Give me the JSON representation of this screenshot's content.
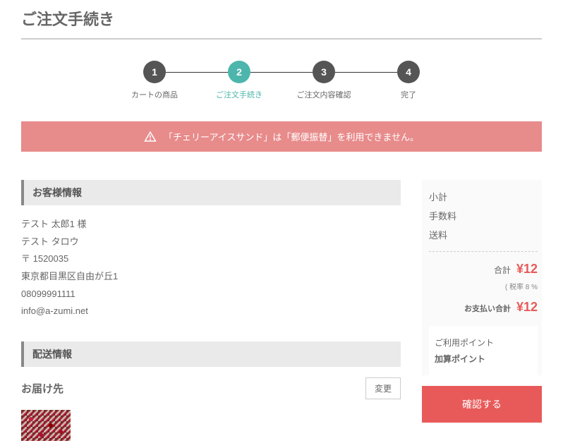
{
  "pageTitle": "ご注文手続き",
  "steps": [
    {
      "num": "1",
      "label": "カートの商品"
    },
    {
      "num": "2",
      "label": "ご注文手続き"
    },
    {
      "num": "3",
      "label": "ご注文内容確認"
    },
    {
      "num": "4",
      "label": "完了"
    }
  ],
  "alert": "「チェリーアイスサンド」は「郵便振替」を利用できません。",
  "sections": {
    "customer": "お客様情報",
    "shipping": "配送情報"
  },
  "customer": {
    "name": "テスト 太郎1 様",
    "kana": "テスト タロウ",
    "zip": "〒 1520035",
    "address": "東京都目黒区自由が丘1",
    "phone": "08099991111",
    "email": "info@a-zumi.net"
  },
  "delivery": {
    "title": "お届け先",
    "changeLabel": "変更"
  },
  "summary": {
    "subtotal": {
      "label": "小計"
    },
    "fee": {
      "label": "手数料"
    },
    "shipping": {
      "label": "送料"
    },
    "total": {
      "label": "合計",
      "value": "¥12"
    },
    "taxNote": "( 税率 8 %",
    "payTotal": {
      "label": "お支払い合計",
      "value": "¥12"
    },
    "usePoints": "ご利用ポイント",
    "addPoints": "加算ポイント",
    "confirm": "確認する"
  }
}
